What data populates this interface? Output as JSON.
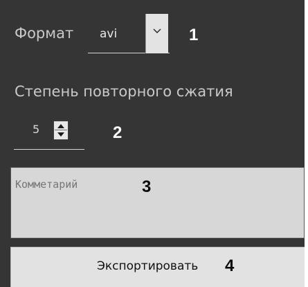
{
  "format": {
    "label": "Формат",
    "value": "avi",
    "callout": "1"
  },
  "compression": {
    "label": "Степень повторного сжатия",
    "value": "5",
    "callout": "2"
  },
  "comment": {
    "placeholder": "Комметарий",
    "callout": "3"
  },
  "export": {
    "label": "Экспортировать",
    "callout": "4"
  },
  "icons": {
    "dropdown": "chevron-down-icon",
    "spin_up": "arrow-up-icon",
    "spin_down": "arrow-down-icon"
  },
  "colors": {
    "panel_background": "#353535",
    "label_text": "#c9c9c9",
    "field_background": "#d7d7d7",
    "button_background": "#e2e2e2",
    "callout_text_light": "#ffffff",
    "callout_text_dark": "#0a0a0a"
  }
}
